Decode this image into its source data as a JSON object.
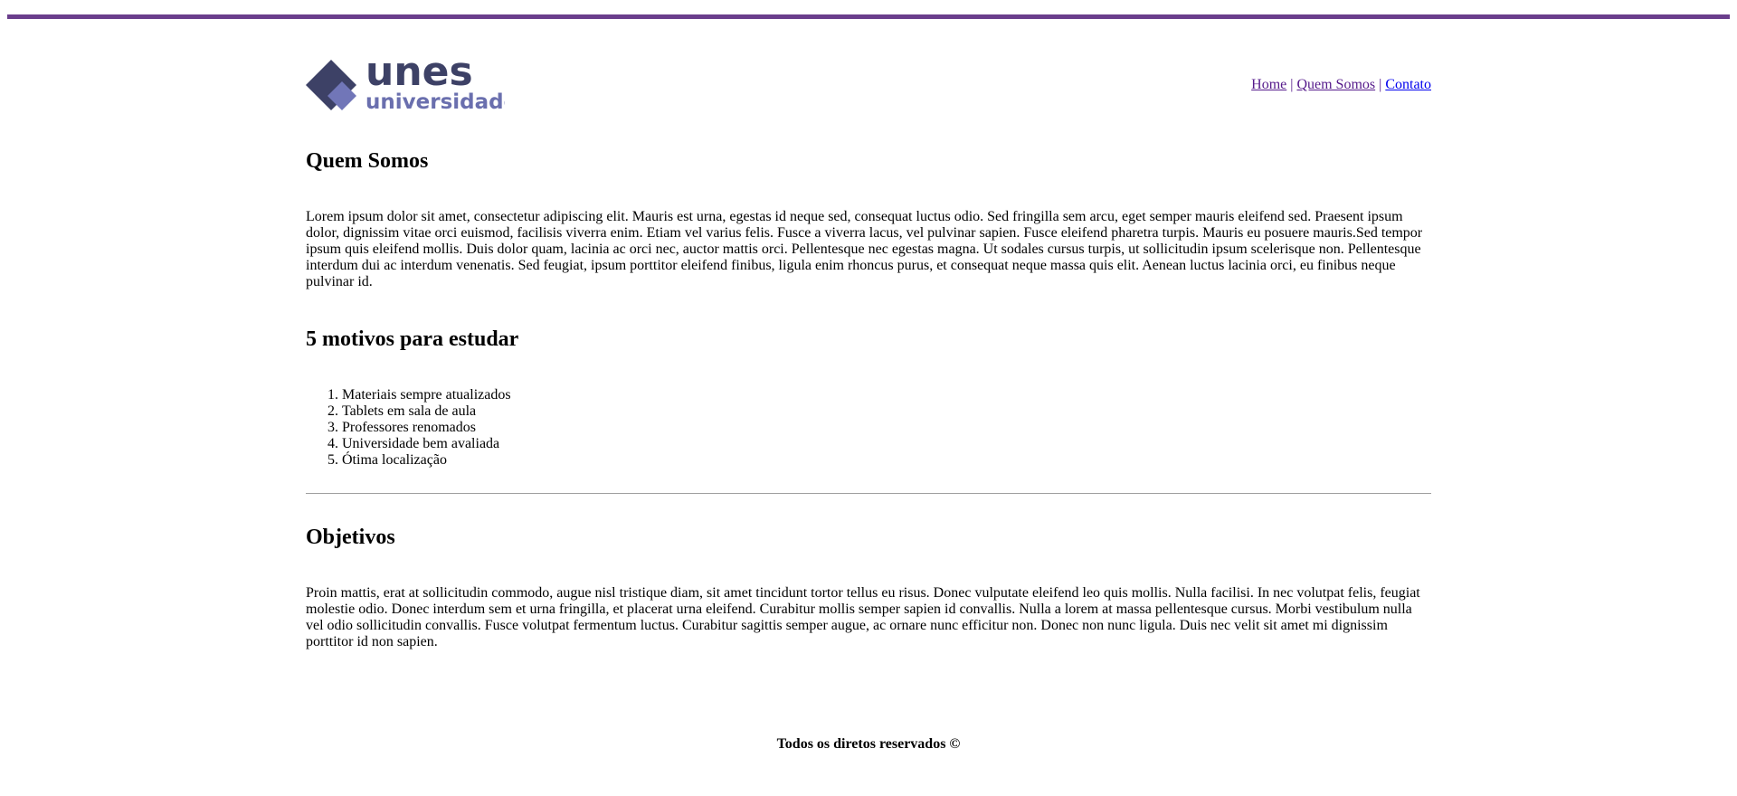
{
  "logo": {
    "brand": "unes",
    "sub": "universidade",
    "colors": {
      "dark": "#3d4166",
      "light": "#7176b8"
    }
  },
  "theme": {
    "accent": "#6a3e8c"
  },
  "nav": {
    "items": [
      {
        "label": "Home"
      },
      {
        "label": "Quem Somos"
      },
      {
        "label": "Contato"
      }
    ],
    "separator": "|"
  },
  "quem_somos": {
    "title": "Quem Somos",
    "text": "Lorem ipsum dolor sit amet, consectetur adipiscing elit. Mauris est urna, egestas id neque sed, consequat luctus odio. Sed fringilla sem arcu, eget semper mauris eleifend sed. Praesent ipsum dolor, dignissim vitae orci euismod, facilisis viverra enim. Etiam vel varius felis. Fusce a viverra lacus, vel pulvinar sapien. Fusce eleifend pharetra turpis. Mauris eu posuere mauris.Sed tempor ipsum quis eleifend mollis. Duis dolor quam, lacinia ac orci nec, auctor mattis orci. Pellentesque nec egestas magna. Ut sodales cursus turpis, ut sollicitudin ipsum scelerisque non. Pellentesque interdum dui ac interdum venenatis. Sed feugiat, ipsum porttitor eleifend finibus, ligula enim rhoncus purus, et consequat neque massa quis elit. Aenean luctus lacinia orci, eu finibus neque pulvinar id."
  },
  "motivos": {
    "title": "5 motivos para estudar",
    "items": [
      "Materiais sempre atualizados",
      "Tablets em sala de aula",
      "Professores renomados",
      "Universidade bem avaliada",
      "Ótima localização"
    ]
  },
  "objetivos": {
    "title": "Objetivos",
    "text": "Proin mattis, erat at sollicitudin commodo, augue nisl tristique diam, sit amet tincidunt tortor tellus eu risus. Donec vulputate eleifend leo quis mollis. Nulla facilisi. In nec volutpat felis, feugiat molestie odio. Donec interdum sem et urna fringilla, et placerat urna eleifend. Curabitur mollis semper sapien id convallis. Nulla a lorem at massa pellentesque cursus. Morbi vestibulum nulla vel odio sollicitudin convallis. Fusce volutpat fermentum luctus. Curabitur sagittis semper augue, ac ornare nunc efficitur non. Donec non nunc ligula. Duis nec velit sit amet mi dignissim porttitor id non sapien."
  },
  "footer": {
    "text": "Todos os diretos reservados ©"
  }
}
